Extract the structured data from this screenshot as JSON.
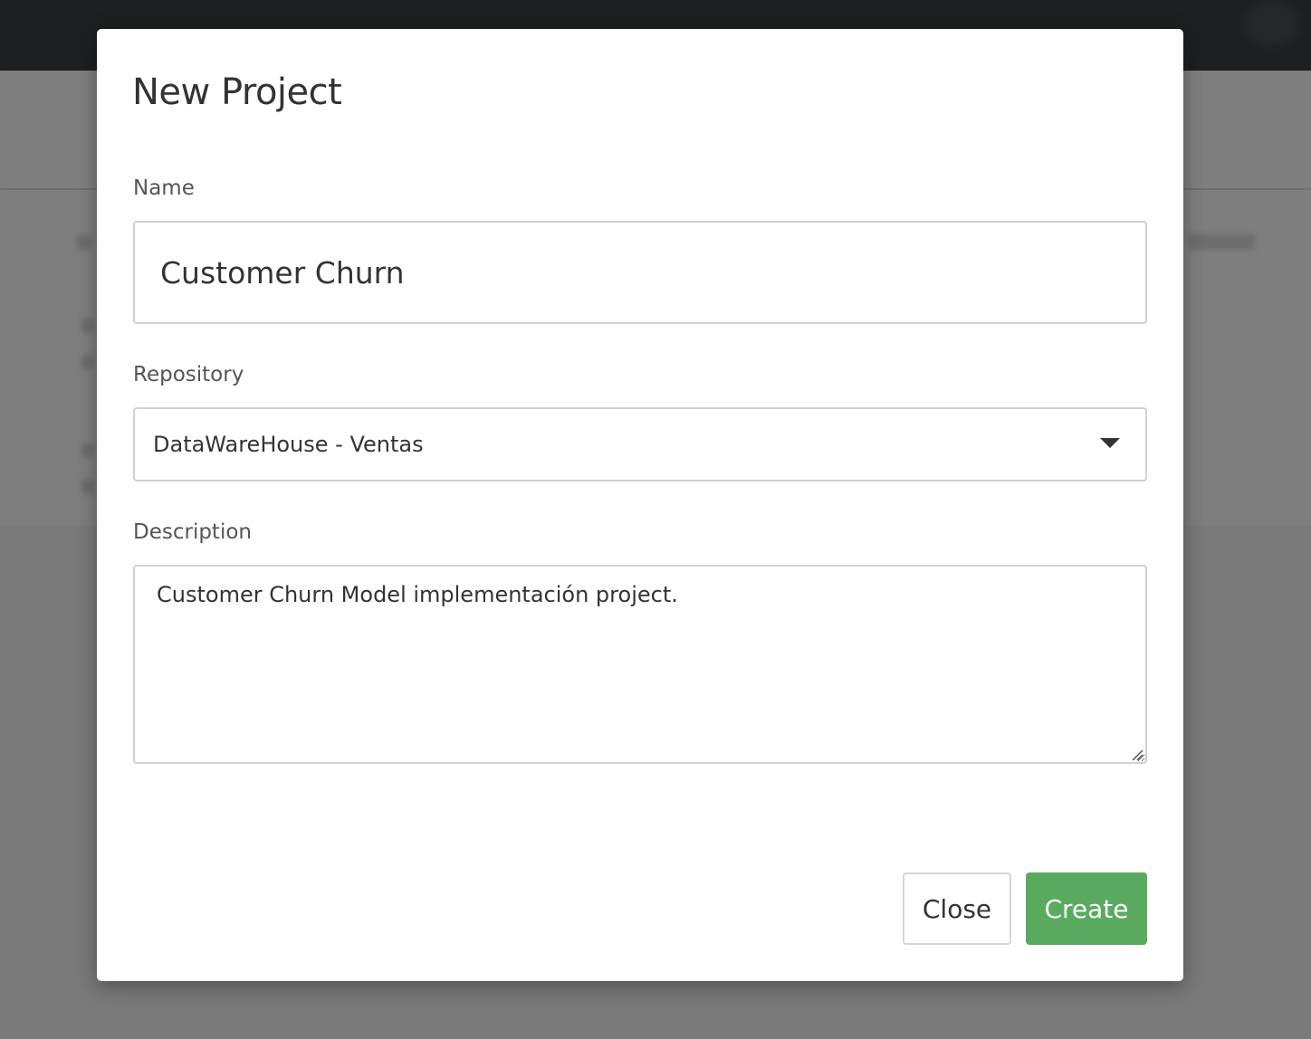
{
  "modal": {
    "title": "New Project",
    "name_field": {
      "label": "Name",
      "value": "Customer Churn"
    },
    "repository_field": {
      "label": "Repository",
      "selected": "DataWareHouse - Ventas"
    },
    "description_field": {
      "label": "Description",
      "value": "Customer Churn Model implementación project."
    },
    "buttons": {
      "close_label": "Close",
      "create_label": "Create"
    }
  },
  "colors": {
    "overlay": "#7a7a7a",
    "topbar": "#1e1f21",
    "primary_button": "#5aab5f",
    "text": "#333333",
    "border": "#d0d0d0"
  },
  "icons": {
    "dropdown": "caret-down-icon",
    "textarea_resize": "resize-grip-icon"
  }
}
